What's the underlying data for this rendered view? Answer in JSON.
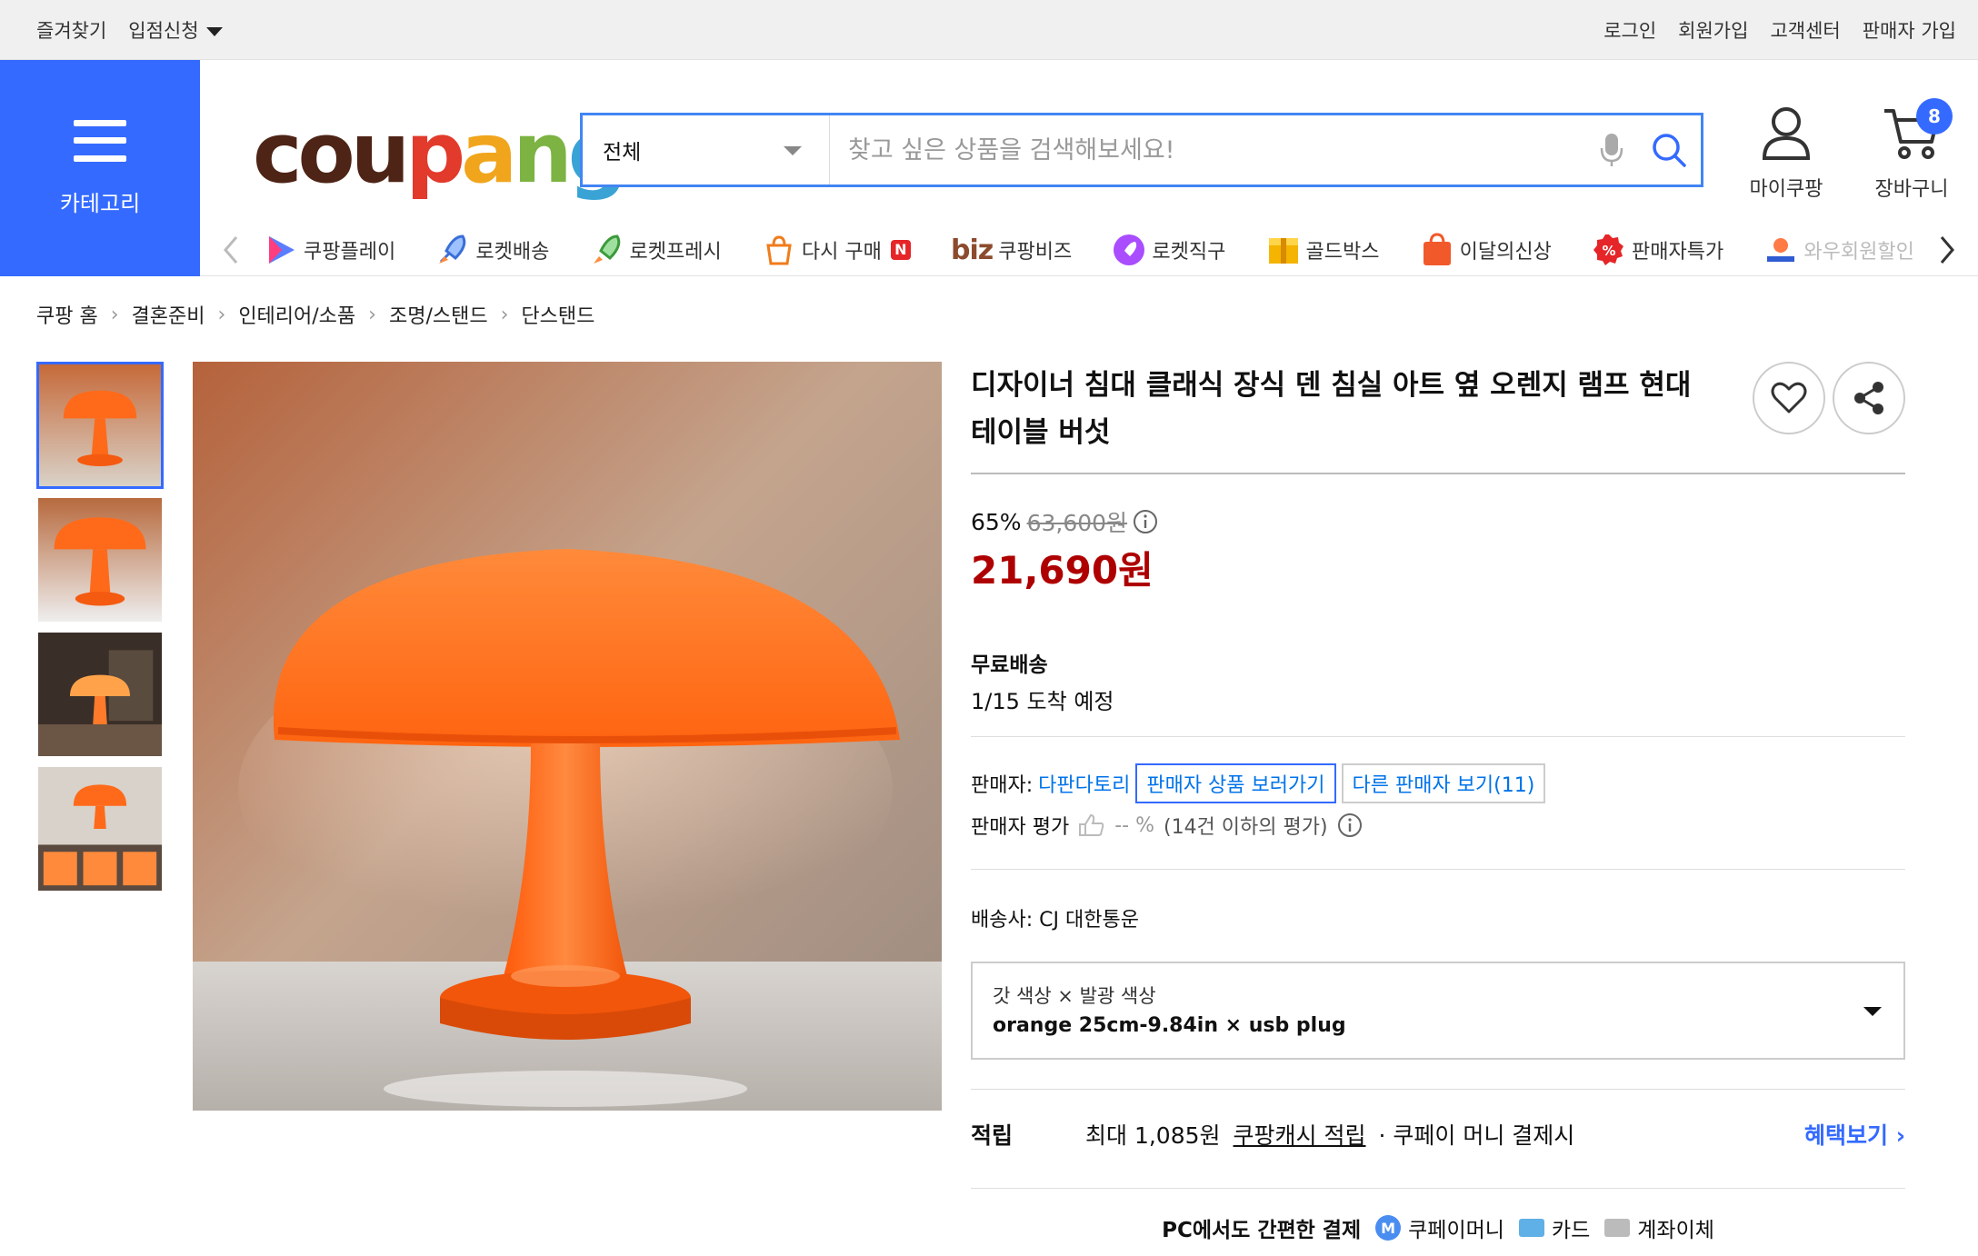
{
  "topbar": {
    "favorites": "즐겨찾기",
    "store_apply": "입점신청",
    "login": "로그인",
    "signup": "회원가입",
    "customer_center": "고객센터",
    "seller_signup": "판매자 가입"
  },
  "header": {
    "category_label": "카테고리",
    "logo_letters": [
      "c",
      "o",
      "u",
      "p",
      "a",
      "n",
      "g"
    ],
    "search": {
      "category": "전체",
      "placeholder": "찾고 싶은 상품을 검색해보세요!"
    },
    "my_coupang": "마이쿠팡",
    "cart": "장바구니",
    "cart_count": "8"
  },
  "quick_menu": [
    {
      "label": "쿠팡플레이",
      "icon": "play-icon"
    },
    {
      "label": "로켓배송",
      "icon": "rocket-icon"
    },
    {
      "label": "로켓프레시",
      "icon": "rocket-fresh-icon"
    },
    {
      "label": "다시 구매",
      "icon": "rebuy-icon",
      "badge": "N"
    },
    {
      "label": "쿠팡비즈",
      "prefix": "biz",
      "icon": "biz-icon"
    },
    {
      "label": "로켓직구",
      "icon": "rocket-global-icon"
    },
    {
      "label": "골드박스",
      "icon": "goldbox-icon"
    },
    {
      "label": "이달의신상",
      "icon": "new-bag-icon"
    },
    {
      "label": "판매자특가",
      "icon": "seller-discount-icon"
    },
    {
      "label": "와우회원할인",
      "icon": "wow-icon"
    }
  ],
  "breadcrumb": [
    "쿠팡 홈",
    "결혼준비",
    "인테리어/소품",
    "조명/스탠드",
    "단스탠드"
  ],
  "product": {
    "title": "디자이너 침대 클래식 장식 덴 침실 아트 옆 오렌지 램프 현대 테이블 버섯",
    "discount_rate": "65%",
    "original_price": "63,600원",
    "price": "21,690원",
    "shipping_type": "무료배송",
    "arrival_date": "1/15",
    "arrival_text": "도착 예정",
    "seller_label": "판매자:",
    "seller_name": "다판다토리",
    "seller_products_btn": "판매자 상품 보러가기",
    "other_sellers_btn": "다른 판매자 보기(11)",
    "seller_rating_label": "판매자 평가",
    "seller_rating_value": "-- %",
    "seller_rating_note": "(14건 이하의 평가)",
    "courier_label": "배송사:",
    "courier_name": "CJ 대한통운",
    "option_label": "갓 색상 × 발광 색상",
    "option_value": "orange 25cm-9.84in × usb plug",
    "reward_label": "적립",
    "reward_max": "최대 1,085원",
    "reward_link": "쿠팡캐시 적립",
    "reward_note": "· 쿠페이 머니 결제시",
    "reward_more": "혜택보기",
    "pay_title": "PC에서도 간편한 결제",
    "pay_money": "쿠페이머니",
    "pay_card": "카드",
    "pay_bank": "계좌이체"
  },
  "colors": {
    "accent": "#346aff",
    "price": "#ae0000",
    "lamp_orange": "#ff6a1a"
  }
}
